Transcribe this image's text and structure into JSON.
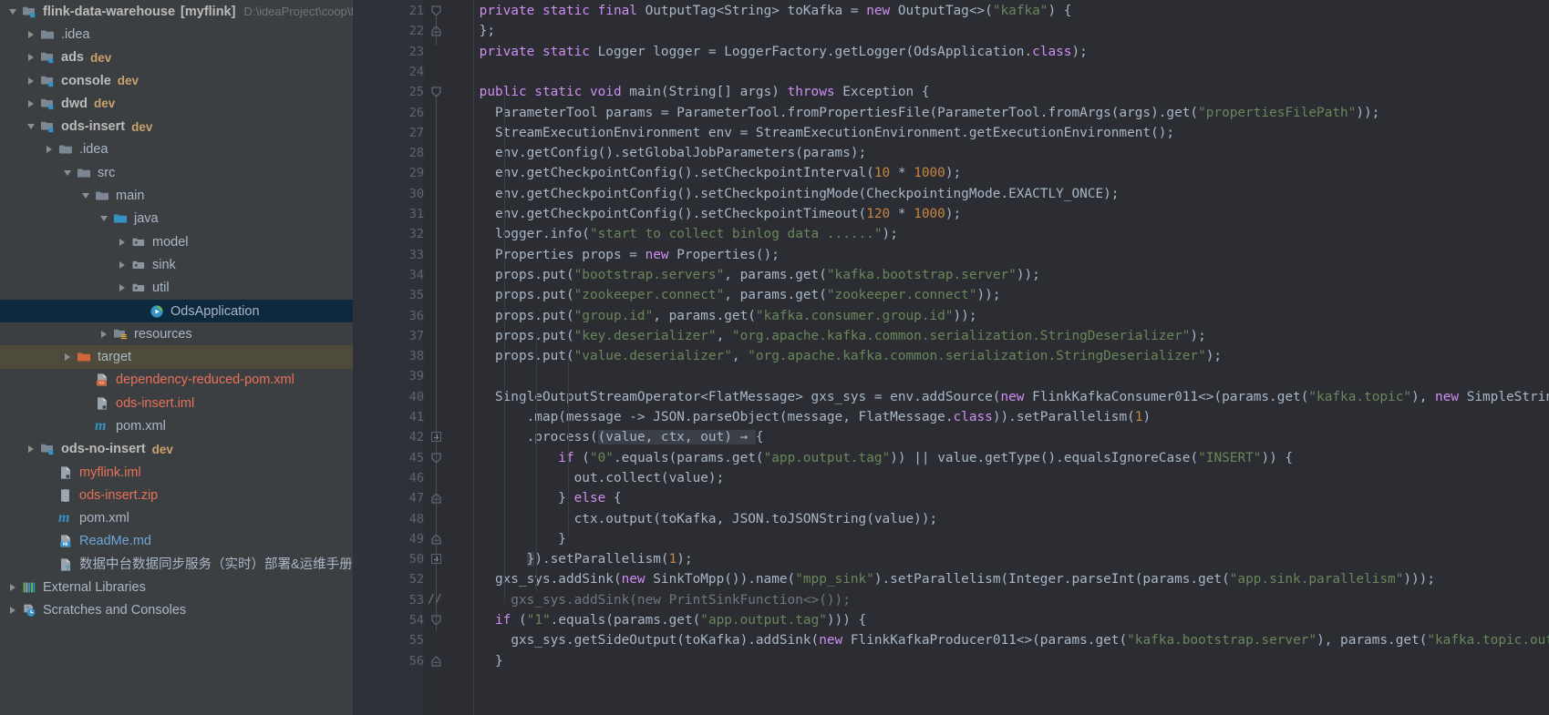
{
  "project_tree": {
    "root_path_hint": "D:\\ideaProject\\coop\\flink-c",
    "items": [
      {
        "id": "flink-data-warehouse",
        "label": "flink-data-warehouse",
        "bracket": "[myflink]",
        "indent": 0,
        "twisty": "down",
        "icon": "module-folder-icon",
        "style": "bold",
        "suffix": "",
        "path_hint": "D:\\ideaProject\\coop\\flink-c"
      },
      {
        "id": "idea-root",
        "label": ".idea",
        "indent": 1,
        "twisty": "right",
        "icon": "folder-icon",
        "style": "grey",
        "suffix": ""
      },
      {
        "id": "ads",
        "label": "ads",
        "indent": 1,
        "twisty": "right",
        "icon": "module-folder-icon",
        "style": "bold",
        "suffix": "dev"
      },
      {
        "id": "console",
        "label": "console",
        "indent": 1,
        "twisty": "right",
        "icon": "module-folder-icon",
        "style": "bold",
        "suffix": "dev"
      },
      {
        "id": "dwd",
        "label": "dwd",
        "indent": 1,
        "twisty": "right",
        "icon": "module-folder-icon",
        "style": "bold",
        "suffix": "dev"
      },
      {
        "id": "ods-insert",
        "label": "ods-insert",
        "indent": 1,
        "twisty": "down",
        "icon": "module-folder-icon",
        "style": "bold",
        "suffix": "dev"
      },
      {
        "id": "ods-insert-idea",
        "label": ".idea",
        "indent": 2,
        "twisty": "right",
        "icon": "folder-icon",
        "style": "grey",
        "suffix": ""
      },
      {
        "id": "src",
        "label": "src",
        "indent": 3,
        "twisty": "down",
        "icon": "folder-icon",
        "style": "grey",
        "suffix": ""
      },
      {
        "id": "main",
        "label": "main",
        "indent": 4,
        "twisty": "down",
        "icon": "folder-icon",
        "style": "grey",
        "suffix": ""
      },
      {
        "id": "java",
        "label": "java",
        "indent": 5,
        "twisty": "down",
        "icon": "source-folder-icon",
        "style": "grey",
        "suffix": ""
      },
      {
        "id": "model",
        "label": "model",
        "indent": 6,
        "twisty": "right",
        "icon": "package-icon",
        "style": "grey",
        "suffix": ""
      },
      {
        "id": "sink",
        "label": "sink",
        "indent": 6,
        "twisty": "right",
        "icon": "package-icon",
        "style": "grey",
        "suffix": ""
      },
      {
        "id": "util",
        "label": "util",
        "indent": 6,
        "twisty": "right",
        "icon": "package-icon",
        "style": "grey",
        "suffix": ""
      },
      {
        "id": "OdsApplication",
        "label": "OdsApplication",
        "indent": 7,
        "twisty": "none",
        "icon": "java-class-runnable-icon",
        "style": "grey",
        "suffix": "",
        "selected": true
      },
      {
        "id": "resources",
        "label": "resources",
        "indent": 5,
        "twisty": "right",
        "icon": "resources-folder-icon",
        "style": "grey",
        "suffix": ""
      },
      {
        "id": "target",
        "label": "target",
        "indent": 3,
        "twisty": "right",
        "icon": "excluded-folder-icon",
        "style": "grey",
        "suffix": "",
        "highlight": true
      },
      {
        "id": "dependency-reduced-pom",
        "label": "dependency-reduced-pom.xml",
        "indent": 4,
        "twisty": "none",
        "icon": "xml-file-icon",
        "style": "orange",
        "suffix": ""
      },
      {
        "id": "ods-insert-iml",
        "label": "ods-insert.iml",
        "indent": 4,
        "twisty": "none",
        "icon": "iml-file-icon",
        "style": "orange",
        "suffix": ""
      },
      {
        "id": "ods-insert-pom",
        "label": "pom.xml",
        "indent": 4,
        "twisty": "none",
        "icon": "maven-icon",
        "style": "grey",
        "suffix": ""
      },
      {
        "id": "ods-no-insert",
        "label": "ods-no-insert",
        "indent": 1,
        "twisty": "right",
        "icon": "module-folder-icon",
        "style": "bold",
        "suffix": "dev"
      },
      {
        "id": "myflink-iml",
        "label": "myflink.iml",
        "indent": 2,
        "twisty": "none",
        "icon": "iml-file-icon",
        "style": "orange",
        "suffix": ""
      },
      {
        "id": "ods-insert-zip",
        "label": "ods-insert.zip",
        "indent": 2,
        "twisty": "none",
        "icon": "archive-icon",
        "style": "orange",
        "suffix": ""
      },
      {
        "id": "root-pom",
        "label": "pom.xml",
        "indent": 2,
        "twisty": "none",
        "icon": "maven-icon",
        "style": "grey",
        "suffix": ""
      },
      {
        "id": "readme",
        "label": "ReadMe.md",
        "indent": 2,
        "twisty": "none",
        "icon": "markdown-icon",
        "style": "blue",
        "suffix": ""
      },
      {
        "id": "docx",
        "label": "数据中台数据同步服务（实时）部署&运维手册.docx",
        "indent": 2,
        "twisty": "none",
        "icon": "unknown-file-icon",
        "style": "grey",
        "suffix": ""
      },
      {
        "id": "external-libraries",
        "label": "External Libraries",
        "indent": 0,
        "twisty": "right",
        "icon": "libraries-icon",
        "style": "grey",
        "suffix": ""
      },
      {
        "id": "scratches",
        "label": "Scratches and Consoles",
        "indent": 0,
        "twisty": "right",
        "icon": "scratches-icon",
        "style": "grey",
        "suffix": ""
      }
    ]
  },
  "editor": {
    "right_margin_column_x": 1460,
    "lines": [
      {
        "n": "21",
        "fold": "arrow-down",
        "indent": 2,
        "tokens": [
          {
            "t": "private static final ",
            "c": "kw2"
          },
          {
            "t": "OutputTag<String> toKafka = ",
            "c": ""
          },
          {
            "t": "new ",
            "c": "kw2"
          },
          {
            "t": "OutputTag<>(",
            "c": ""
          },
          {
            "t": "\"kafka\"",
            "c": "str"
          },
          {
            "t": ") {",
            "c": ""
          }
        ]
      },
      {
        "n": "22",
        "fold": "arrow-up",
        "indent": 2,
        "tokens": [
          {
            "t": "};",
            "c": ""
          }
        ]
      },
      {
        "n": "23",
        "fold": "",
        "indent": 2,
        "tokens": [
          {
            "t": "private static ",
            "c": "kw2"
          },
          {
            "t": "Logger logger = LoggerFactory.getLogger(OdsApplication.",
            "c": ""
          },
          {
            "t": "class",
            "c": "kw2"
          },
          {
            "t": ");",
            "c": ""
          }
        ]
      },
      {
        "n": "24",
        "fold": "",
        "indent": 2,
        "tokens": [
          {
            "t": "",
            "c": ""
          }
        ]
      },
      {
        "n": "25",
        "fold": "arrow-down",
        "indent": 2,
        "tokens": [
          {
            "t": "public static void ",
            "c": "kw2"
          },
          {
            "t": "main(String[] args) ",
            "c": ""
          },
          {
            "t": "throws ",
            "c": "kw2"
          },
          {
            "t": "Exception {",
            "c": ""
          }
        ]
      },
      {
        "n": "26",
        "fold": "",
        "indent": 3,
        "tokens": [
          {
            "t": "ParameterTool params = ParameterTool.fromPropertiesFile(ParameterTool.fromArgs(args).get(",
            "c": ""
          },
          {
            "t": "\"propertiesFilePath\"",
            "c": "str"
          },
          {
            "t": "));",
            "c": ""
          }
        ]
      },
      {
        "n": "27",
        "fold": "",
        "indent": 3,
        "tokens": [
          {
            "t": "StreamExecutionEnvironment env = StreamExecutionEnvironment.getExecutionEnvironment();",
            "c": ""
          }
        ]
      },
      {
        "n": "28",
        "fold": "",
        "indent": 3,
        "tokens": [
          {
            "t": "env.getConfig().setGlobalJobParameters(params);",
            "c": ""
          }
        ]
      },
      {
        "n": "29",
        "fold": "",
        "indent": 3,
        "tokens": [
          {
            "t": "env.getCheckpointConfig().setCheckpointInterval(",
            "c": ""
          },
          {
            "t": "10",
            "c": "num"
          },
          {
            "t": " * ",
            "c": ""
          },
          {
            "t": "1000",
            "c": "num"
          },
          {
            "t": ");",
            "c": ""
          }
        ]
      },
      {
        "n": "30",
        "fold": "",
        "indent": 3,
        "tokens": [
          {
            "t": "env.getCheckpointConfig().setCheckpointingMode(CheckpointingMode.EXACTLY_ONCE);",
            "c": ""
          }
        ]
      },
      {
        "n": "31",
        "fold": "",
        "indent": 3,
        "tokens": [
          {
            "t": "env.getCheckpointConfig().setCheckpointTimeout(",
            "c": ""
          },
          {
            "t": "120",
            "c": "num"
          },
          {
            "t": " * ",
            "c": ""
          },
          {
            "t": "1000",
            "c": "num"
          },
          {
            "t": ");",
            "c": ""
          }
        ]
      },
      {
        "n": "32",
        "fold": "",
        "indent": 3,
        "tokens": [
          {
            "t": "logger.info(",
            "c": ""
          },
          {
            "t": "\"start to collect binlog data ......\"",
            "c": "str"
          },
          {
            "t": ");",
            "c": ""
          }
        ]
      },
      {
        "n": "33",
        "fold": "",
        "indent": 3,
        "tokens": [
          {
            "t": "Properties props = ",
            "c": ""
          },
          {
            "t": "new ",
            "c": "kw2"
          },
          {
            "t": "Properties();",
            "c": ""
          }
        ]
      },
      {
        "n": "34",
        "fold": "",
        "indent": 3,
        "tokens": [
          {
            "t": "props.put(",
            "c": ""
          },
          {
            "t": "\"bootstrap.servers\"",
            "c": "str"
          },
          {
            "t": ", params.get(",
            "c": ""
          },
          {
            "t": "\"kafka.bootstrap.server\"",
            "c": "str"
          },
          {
            "t": "));",
            "c": ""
          }
        ]
      },
      {
        "n": "35",
        "fold": "",
        "indent": 3,
        "tokens": [
          {
            "t": "props.put(",
            "c": ""
          },
          {
            "t": "\"zookeeper.connect\"",
            "c": "str"
          },
          {
            "t": ", params.get(",
            "c": ""
          },
          {
            "t": "\"zookeeper.connect\"",
            "c": "str"
          },
          {
            "t": "));",
            "c": ""
          }
        ]
      },
      {
        "n": "36",
        "fold": "",
        "indent": 3,
        "tokens": [
          {
            "t": "props.put(",
            "c": ""
          },
          {
            "t": "\"group.id\"",
            "c": "str"
          },
          {
            "t": ", params.get(",
            "c": ""
          },
          {
            "t": "\"kafka.consumer.group.id\"",
            "c": "str"
          },
          {
            "t": "));",
            "c": ""
          }
        ]
      },
      {
        "n": "37",
        "fold": "",
        "indent": 3,
        "tokens": [
          {
            "t": "props.put(",
            "c": ""
          },
          {
            "t": "\"key.deserializer\"",
            "c": "str"
          },
          {
            "t": ", ",
            "c": ""
          },
          {
            "t": "\"org.apache.kafka.common.serialization.StringDeserializer\"",
            "c": "str"
          },
          {
            "t": ");",
            "c": ""
          }
        ]
      },
      {
        "n": "38",
        "fold": "",
        "indent": 3,
        "tokens": [
          {
            "t": "props.put(",
            "c": ""
          },
          {
            "t": "\"value.deserializer\"",
            "c": "str"
          },
          {
            "t": ", ",
            "c": ""
          },
          {
            "t": "\"org.apache.kafka.common.serialization.StringDeserializer\"",
            "c": "str"
          },
          {
            "t": ");",
            "c": ""
          }
        ]
      },
      {
        "n": "39",
        "fold": "",
        "indent": 3,
        "tokens": [
          {
            "t": "",
            "c": ""
          }
        ]
      },
      {
        "n": "40",
        "fold": "",
        "indent": 3,
        "tokens": [
          {
            "t": "SingleOutputStreamOperator<FlatMessage> gxs_sys = env.addSource(",
            "c": ""
          },
          {
            "t": "new ",
            "c": "kw2"
          },
          {
            "t": "FlinkKafkaConsumer011<>(params.get(",
            "c": ""
          },
          {
            "t": "\"kafka.topic\"",
            "c": "str"
          },
          {
            "t": "), ",
            "c": ""
          },
          {
            "t": "new ",
            "c": "kw2"
          },
          {
            "t": "SimpleStringSchema(",
            "c": ""
          }
        ]
      },
      {
        "n": "41",
        "fold": "",
        "indent": 5,
        "tokens": [
          {
            "t": ".map(message -> JSON.parseObject(message, FlatMessage.",
            "c": ""
          },
          {
            "t": "class",
            "c": "kw2"
          },
          {
            "t": ")).setParallelism(",
            "c": ""
          },
          {
            "t": "1",
            "c": "num"
          },
          {
            "t": ")",
            "c": ""
          }
        ]
      },
      {
        "n": "42",
        "fold": "plus",
        "indent": 5,
        "tokens": [
          {
            "t": ".process(",
            "c": ""
          },
          {
            "t": "(value, ctx, out) → ",
            "c": "fld"
          },
          {
            "t": "{",
            "c": ""
          }
        ]
      },
      {
        "n": "45",
        "fold": "arrow-down",
        "indent": 7,
        "tokens": [
          {
            "t": "if ",
            "c": "kw2"
          },
          {
            "t": "(",
            "c": ""
          },
          {
            "t": "\"0\"",
            "c": "str"
          },
          {
            "t": ".equals(params.get(",
            "c": ""
          },
          {
            "t": "\"app.output.tag\"",
            "c": "str"
          },
          {
            "t": ")) || value.getType().equalsIgnoreCase(",
            "c": ""
          },
          {
            "t": "\"INSERT\"",
            "c": "str"
          },
          {
            "t": ")) {",
            "c": ""
          }
        ]
      },
      {
        "n": "46",
        "fold": "",
        "indent": 8,
        "tokens": [
          {
            "t": "out.collect(value);",
            "c": ""
          }
        ]
      },
      {
        "n": "47",
        "fold": "arrow-up",
        "indent": 7,
        "tokens": [
          {
            "t": "} ",
            "c": ""
          },
          {
            "t": "else ",
            "c": "kw2"
          },
          {
            "t": "{",
            "c": ""
          }
        ]
      },
      {
        "n": "48",
        "fold": "",
        "indent": 8,
        "tokens": [
          {
            "t": "ctx.output(toKafka, JSON.toJSONString(value));",
            "c": ""
          }
        ]
      },
      {
        "n": "49",
        "fold": "arrow-up",
        "indent": 7,
        "tokens": [
          {
            "t": "}",
            "c": ""
          }
        ]
      },
      {
        "n": "50",
        "fold": "plus",
        "indent": 5,
        "tokens": [
          {
            "t": "}",
            "c": "fld"
          },
          {
            "t": ").setParallelism(",
            "c": ""
          },
          {
            "t": "1",
            "c": "num"
          },
          {
            "t": ");",
            "c": ""
          }
        ]
      },
      {
        "n": "52",
        "fold": "",
        "indent": 3,
        "tokens": [
          {
            "t": "gxs_sys.addSink(",
            "c": ""
          },
          {
            "t": "new ",
            "c": "kw2"
          },
          {
            "t": "SinkToMpp()).name(",
            "c": ""
          },
          {
            "t": "\"mpp_sink\"",
            "c": "str"
          },
          {
            "t": ").setParallelism(Integer.parseInt(params.get(",
            "c": ""
          },
          {
            "t": "\"app.sink.parallelism\"",
            "c": "str"
          },
          {
            "t": ")));",
            "c": ""
          }
        ]
      },
      {
        "n": "53",
        "fold": "comment",
        "indent": 3,
        "tokens": [
          {
            "t": "  gxs_sys.addSink(new PrintSinkFunction<>());",
            "c": "cmt"
          }
        ]
      },
      {
        "n": "54",
        "fold": "arrow-down",
        "indent": 3,
        "tokens": [
          {
            "t": "if ",
            "c": "kw2"
          },
          {
            "t": "(",
            "c": ""
          },
          {
            "t": "\"1\"",
            "c": "str"
          },
          {
            "t": ".equals(params.get(",
            "c": ""
          },
          {
            "t": "\"app.output.tag\"",
            "c": "str"
          },
          {
            "t": "))) {",
            "c": ""
          }
        ]
      },
      {
        "n": "55",
        "fold": "",
        "indent": 4,
        "tokens": [
          {
            "t": "gxs_sys.getSideOutput(toKafka).addSink(",
            "c": ""
          },
          {
            "t": "new ",
            "c": "kw2"
          },
          {
            "t": "FlinkKafkaProducer011<>(params.get(",
            "c": ""
          },
          {
            "t": "\"kafka.bootstrap.server\"",
            "c": "str"
          },
          {
            "t": "), params.get(",
            "c": ""
          },
          {
            "t": "\"kafka.topic.out\"",
            "c": "str"
          },
          {
            "t": "), ne",
            "c": ""
          }
        ]
      },
      {
        "n": "56",
        "fold": "arrow-up",
        "indent": 3,
        "tokens": [
          {
            "t": "}",
            "c": ""
          }
        ]
      }
    ]
  },
  "colors": {
    "panel_bg": "#3c3f41",
    "editor_bg": "#2b2d33",
    "gutter_bg": "#2f3138",
    "selection_bg": "#0d293e",
    "excluded_bg": "#4e4a3c",
    "text": "#a9b7c6",
    "keyword": "#cc7832",
    "keyword_alt": "#cf8ef2",
    "string": "#6a8759",
    "number": "#c9853f",
    "comment": "#72767d",
    "module_suffix": "#c9a26d"
  }
}
